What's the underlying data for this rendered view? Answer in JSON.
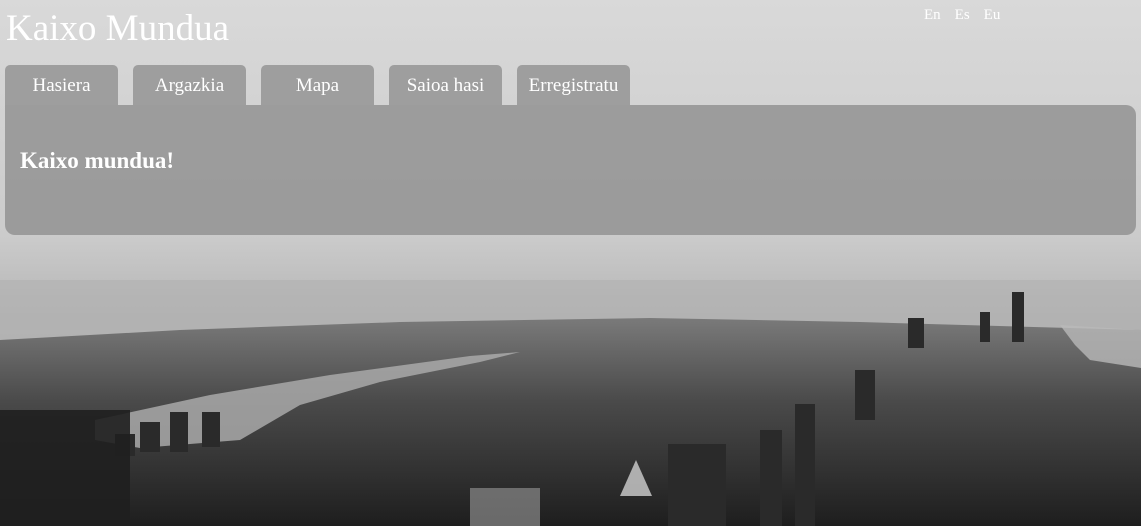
{
  "header": {
    "site_title": "Kaixo Mundua",
    "languages": [
      "En",
      "Es",
      "Eu"
    ]
  },
  "nav": {
    "tabs": [
      {
        "label": "Hasiera",
        "active": true
      },
      {
        "label": "Argazkia",
        "active": false
      },
      {
        "label": "Mapa",
        "active": false
      },
      {
        "label": "Saioa hasi",
        "active": false
      },
      {
        "label": "Erregistratu",
        "active": false
      }
    ]
  },
  "main": {
    "heading": "Kaixo mundua!"
  },
  "theme": {
    "panel_color": "#969696",
    "text_color": "#ffffff"
  }
}
